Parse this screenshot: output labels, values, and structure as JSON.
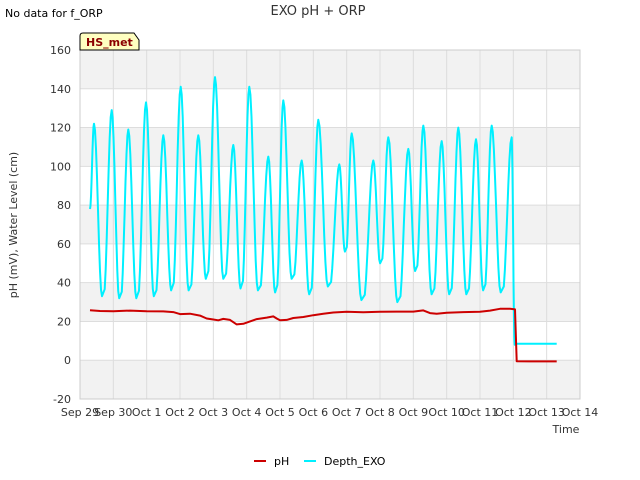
{
  "chart_data": {
    "type": "line",
    "title": "EXO pH + ORP",
    "corner_note": "No data for f_ORP",
    "badge": "HS_met",
    "xlabel": "Time",
    "ylabel": "pH (mV), Water Level (cm)",
    "ylim": [
      -20,
      160
    ],
    "yticks": [
      -20,
      0,
      20,
      40,
      60,
      80,
      100,
      120,
      140,
      160
    ],
    "xlim": [
      0,
      15
    ],
    "xticks": [
      {
        "x": 0,
        "label": "Sep 29"
      },
      {
        "x": 1,
        "label": "Sep 30"
      },
      {
        "x": 2,
        "label": "Oct 1"
      },
      {
        "x": 3,
        "label": "Oct 2"
      },
      {
        "x": 4,
        "label": "Oct 3"
      },
      {
        "x": 5,
        "label": "Oct 4"
      },
      {
        "x": 6,
        "label": "Oct 5"
      },
      {
        "x": 7,
        "label": "Oct 6"
      },
      {
        "x": 8,
        "label": "Oct 7"
      },
      {
        "x": 9,
        "label": "Oct 8"
      },
      {
        "x": 10,
        "label": "Oct 9"
      },
      {
        "x": 11,
        "label": "Oct 10"
      },
      {
        "x": 12,
        "label": "Oct 11"
      },
      {
        "x": 13,
        "label": "Oct 12"
      },
      {
        "x": 14,
        "label": "Oct 13"
      },
      {
        "x": 15,
        "label": "Oct 14"
      }
    ],
    "grid": true,
    "legend_position": "bottom-center",
    "series": [
      {
        "name": "pH",
        "color": "#cc0000",
        "points": [
          [
            0.3,
            25.8
          ],
          [
            0.6,
            25.4
          ],
          [
            1.0,
            25.3
          ],
          [
            1.5,
            25.6
          ],
          [
            2.0,
            25.3
          ],
          [
            2.5,
            25.2
          ],
          [
            2.8,
            24.8
          ],
          [
            3.0,
            23.8
          ],
          [
            3.3,
            24.0
          ],
          [
            3.6,
            23.0
          ],
          [
            3.8,
            21.5
          ],
          [
            4.0,
            21.0
          ],
          [
            4.15,
            20.6
          ],
          [
            4.3,
            21.3
          ],
          [
            4.5,
            20.8
          ],
          [
            4.7,
            18.5
          ],
          [
            4.9,
            18.8
          ],
          [
            5.1,
            20.0
          ],
          [
            5.3,
            21.2
          ],
          [
            5.6,
            22.0
          ],
          [
            5.8,
            22.6
          ],
          [
            5.9,
            21.5
          ],
          [
            6.0,
            20.6
          ],
          [
            6.2,
            20.8
          ],
          [
            6.4,
            21.8
          ],
          [
            6.7,
            22.3
          ],
          [
            7.0,
            23.2
          ],
          [
            7.3,
            24.0
          ],
          [
            7.6,
            24.6
          ],
          [
            8.0,
            25.0
          ],
          [
            8.5,
            24.7
          ],
          [
            9.0,
            25.0
          ],
          [
            9.5,
            25.1
          ],
          [
            10.0,
            25.1
          ],
          [
            10.3,
            25.7
          ],
          [
            10.5,
            24.3
          ],
          [
            10.7,
            24.0
          ],
          [
            11.0,
            24.5
          ],
          [
            11.5,
            24.8
          ],
          [
            12.0,
            25.0
          ],
          [
            12.3,
            25.6
          ],
          [
            12.6,
            26.5
          ],
          [
            12.9,
            26.5
          ],
          [
            13.05,
            26.2
          ],
          [
            13.1,
            -0.5
          ],
          [
            13.5,
            -0.6
          ],
          [
            14.0,
            -0.6
          ],
          [
            14.3,
            -0.6
          ]
        ]
      },
      {
        "name": "Depth_EXO",
        "color": "#00f0ff",
        "cycles": [
          {
            "x": 0.42,
            "peak": 122,
            "trough": 33
          },
          {
            "x": 0.95,
            "peak": 129,
            "trough": 32
          },
          {
            "x": 1.45,
            "peak": 119,
            "trough": 32
          },
          {
            "x": 1.98,
            "peak": 133,
            "trough": 33
          },
          {
            "x": 2.5,
            "peak": 116,
            "trough": 36
          },
          {
            "x": 3.02,
            "peak": 141,
            "trough": 36
          },
          {
            "x": 3.55,
            "peak": 116,
            "trough": 42
          },
          {
            "x": 4.05,
            "peak": 146,
            "trough": 42
          },
          {
            "x": 4.6,
            "peak": 111,
            "trough": 37
          },
          {
            "x": 5.08,
            "peak": 141,
            "trough": 36
          },
          {
            "x": 5.65,
            "peak": 105,
            "trough": 35
          },
          {
            "x": 6.1,
            "peak": 134,
            "trough": 42
          },
          {
            "x": 6.65,
            "peak": 103,
            "trough": 34
          },
          {
            "x": 7.15,
            "peak": 124,
            "trough": 38
          },
          {
            "x": 7.78,
            "peak": 101,
            "trough": 56
          },
          {
            "x": 8.15,
            "peak": 117,
            "trough": 31
          },
          {
            "x": 8.8,
            "peak": 103,
            "trough": 50
          },
          {
            "x": 9.25,
            "peak": 115,
            "trough": 30
          },
          {
            "x": 9.85,
            "peak": 109,
            "trough": 46
          },
          {
            "x": 10.3,
            "peak": 121,
            "trough": 34
          },
          {
            "x": 10.85,
            "peak": 113,
            "trough": 34
          },
          {
            "x": 11.35,
            "peak": 120,
            "trough": 34
          },
          {
            "x": 11.88,
            "peak": 114,
            "trough": 36
          },
          {
            "x": 12.35,
            "peak": 121,
            "trough": 35
          },
          {
            "x": 12.95,
            "peak": 115,
            "trough": 8
          }
        ],
        "start": [
          0.3,
          78
        ],
        "tail": [
          [
            13.1,
            8.5
          ],
          [
            14.3,
            8.5
          ]
        ]
      }
    ]
  }
}
